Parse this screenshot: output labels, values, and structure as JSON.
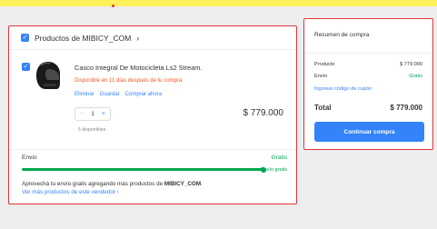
{
  "colors": {
    "accent": "#3483fa",
    "success": "#00a650",
    "warning": "#f15a24",
    "highlight_border": "#e2343c",
    "top_bar": "#fff159"
  },
  "cart": {
    "seller_title": "Productos de MIBICY_COM",
    "chevron_icon": "chevron-right-icon",
    "product": {
      "title": "Casco Integral De Motocicleta Ls2 Stream.",
      "shipping_note": "Disponible en 11 días después de tu compra",
      "actions": [
        "Eliminar",
        "Guardar",
        "Comprar ahora"
      ],
      "quantity": "1",
      "available": "5 disponibles",
      "price": "$ 779.000",
      "image_icon": "helmet-icon"
    },
    "shipping": {
      "label": "Envío",
      "value": "Gratis",
      "progress_label": "Envío gratis",
      "progress": 1.0
    },
    "promo": {
      "prefix": "Aprovechá tu envío gratis agregando más productos de",
      "seller": "MIBICY_COM",
      "suffix": "."
    },
    "more_link": "Ver más productos de este vendedor ›"
  },
  "summary": {
    "title": "Resumen de compra",
    "product_label": "Producto",
    "product_value": "$ 779.000",
    "shipping_label": "Envío",
    "shipping_value": "Gratis",
    "coupon_link": "Ingresar código de cupón",
    "total_label": "Total",
    "total_value": "$ 779.000",
    "continue_button": "Continuar compra"
  }
}
